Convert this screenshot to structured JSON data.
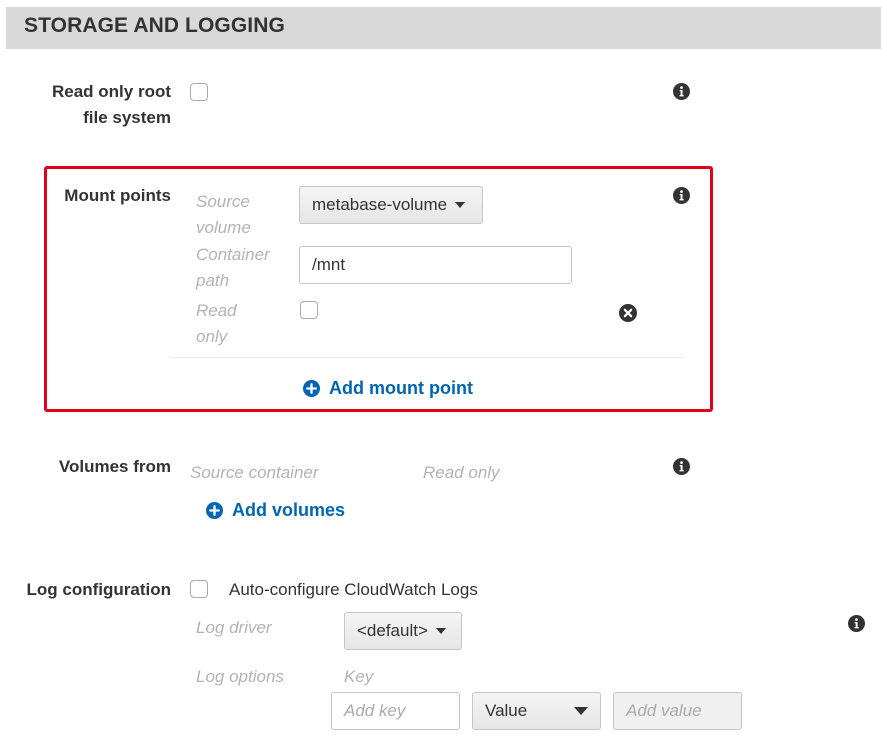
{
  "section": {
    "title": "STORAGE AND LOGGING"
  },
  "read_only_root": {
    "label_line1": "Read only root",
    "label_line2": "file system",
    "checked": false
  },
  "mount_points": {
    "label": "Mount points",
    "source_volume_label_1": "Source",
    "source_volume_label_2": "volume",
    "source_volume_value": "metabase-volume",
    "container_path_label_1": "Container",
    "container_path_label_2": "path",
    "container_path_value": "/mnt",
    "read_only_label_1": "Read",
    "read_only_label_2": "only",
    "read_only_checked": false,
    "add_label": "Add mount point",
    "highlight_color": "#e3001b"
  },
  "volumes_from": {
    "label": "Volumes from",
    "col_source": "Source container",
    "col_read_only": "Read only",
    "add_label": "Add volumes"
  },
  "log_configuration": {
    "label": "Log configuration",
    "auto_configure_label": "Auto-configure CloudWatch Logs",
    "auto_configure_checked": false,
    "log_driver_label": "Log driver",
    "log_driver_value": "<default>",
    "log_options_label": "Log options",
    "key_header": "Key",
    "key_placeholder": "Add key",
    "value_type": "Value",
    "value_placeholder": "Add value"
  },
  "colors": {
    "link": "#0066b3",
    "header_bg": "#d9d9d9",
    "muted_label": "#b3b3b3"
  },
  "icons": {
    "info": "info-icon",
    "plus": "plus-circle-icon",
    "close": "close-circle-icon"
  }
}
